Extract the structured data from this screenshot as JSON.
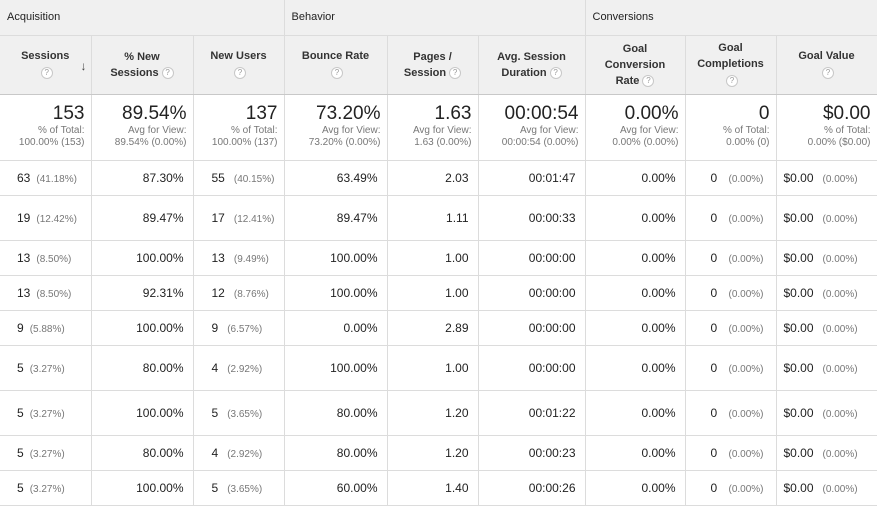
{
  "groups": {
    "acquisition": "Acquisition",
    "behavior": "Behavior",
    "conversions": "Conversions"
  },
  "columns": {
    "sessions": "Sessions",
    "new_sessions": [
      "% New",
      "Sessions"
    ],
    "new_users": "New Users",
    "bounce_rate": "Bounce Rate",
    "pages_session": [
      "Pages /",
      "Session"
    ],
    "avg_duration": [
      "Avg. Session",
      "Duration"
    ],
    "goal_conv": [
      "Goal",
      "Conversion",
      "Rate"
    ],
    "goal_compl": [
      "Goal",
      "Completions"
    ],
    "goal_value": "Goal Value",
    "help_glyph": "?",
    "sort_glyph": "↓"
  },
  "totals": {
    "sessions": {
      "value": "153",
      "l1": "% of Total:",
      "l2": "100.00% (153)"
    },
    "new_sessions": {
      "value": "89.54%",
      "l1": "Avg for View:",
      "l2": "89.54% (0.00%)"
    },
    "new_users": {
      "value": "137",
      "l1": "% of Total:",
      "l2": "100.00% (137)"
    },
    "bounce_rate": {
      "value": "73.20%",
      "l1": "Avg for View:",
      "l2": "73.20% (0.00%)"
    },
    "pages_session": {
      "value": "1.63",
      "l1": "Avg for View:",
      "l2": "1.63 (0.00%)"
    },
    "avg_duration": {
      "value": "00:00:54",
      "l1": "Avg for View:",
      "l2": "00:00:54 (0.00%)"
    },
    "goal_conv": {
      "value": "0.00%",
      "l1": "Avg for View:",
      "l2": "0.00% (0.00%)"
    },
    "goal_compl": {
      "value": "0",
      "l1": "% of Total:",
      "l2": "0.00% (0)"
    },
    "goal_value": {
      "value": "$0.00",
      "l1": "% of Total:",
      "l2": "0.00% ($0.00)"
    }
  },
  "rows": [
    {
      "s": "63",
      "sp": "(41.18%)",
      "ns": "87.30%",
      "nu": "55",
      "nup": "(40.15%)",
      "br": "63.49%",
      "ps": "2.03",
      "dur": "00:01:47",
      "gcr": "0.00%",
      "gc": "0",
      "gcp": "(0.00%)",
      "gv": "$0.00",
      "gvp": "(0.00%)"
    },
    {
      "s": "19",
      "sp": "(12.42%)",
      "ns": "89.47%",
      "nu": "17",
      "nup": "(12.41%)",
      "br": "89.47%",
      "ps": "1.11",
      "dur": "00:00:33",
      "gcr": "0.00%",
      "gc": "0",
      "gcp": "(0.00%)",
      "gv": "$0.00",
      "gvp": "(0.00%)"
    },
    {
      "s": "13",
      "sp": "(8.50%)",
      "ns": "100.00%",
      "nu": "13",
      "nup": "(9.49%)",
      "br": "100.00%",
      "ps": "1.00",
      "dur": "00:00:00",
      "gcr": "0.00%",
      "gc": "0",
      "gcp": "(0.00%)",
      "gv": "$0.00",
      "gvp": "(0.00%)"
    },
    {
      "s": "13",
      "sp": "(8.50%)",
      "ns": "92.31%",
      "nu": "12",
      "nup": "(8.76%)",
      "br": "100.00%",
      "ps": "1.00",
      "dur": "00:00:00",
      "gcr": "0.00%",
      "gc": "0",
      "gcp": "(0.00%)",
      "gv": "$0.00",
      "gvp": "(0.00%)"
    },
    {
      "s": "9",
      "sp": "(5.88%)",
      "ns": "100.00%",
      "nu": "9",
      "nup": "(6.57%)",
      "br": "0.00%",
      "ps": "2.89",
      "dur": "00:00:00",
      "gcr": "0.00%",
      "gc": "0",
      "gcp": "(0.00%)",
      "gv": "$0.00",
      "gvp": "(0.00%)"
    },
    {
      "s": "5",
      "sp": "(3.27%)",
      "ns": "80.00%",
      "nu": "4",
      "nup": "(2.92%)",
      "br": "100.00%",
      "ps": "1.00",
      "dur": "00:00:00",
      "gcr": "0.00%",
      "gc": "0",
      "gcp": "(0.00%)",
      "gv": "$0.00",
      "gvp": "(0.00%)"
    },
    {
      "s": "5",
      "sp": "(3.27%)",
      "ns": "100.00%",
      "nu": "5",
      "nup": "(3.65%)",
      "br": "80.00%",
      "ps": "1.20",
      "dur": "00:01:22",
      "gcr": "0.00%",
      "gc": "0",
      "gcp": "(0.00%)",
      "gv": "$0.00",
      "gvp": "(0.00%)"
    },
    {
      "s": "5",
      "sp": "(3.27%)",
      "ns": "80.00%",
      "nu": "4",
      "nup": "(2.92%)",
      "br": "80.00%",
      "ps": "1.20",
      "dur": "00:00:23",
      "gcr": "0.00%",
      "gc": "0",
      "gcp": "(0.00%)",
      "gv": "$0.00",
      "gvp": "(0.00%)"
    },
    {
      "s": "5",
      "sp": "(3.27%)",
      "ns": "100.00%",
      "nu": "5",
      "nup": "(3.65%)",
      "br": "60.00%",
      "ps": "1.40",
      "dur": "00:00:26",
      "gcr": "0.00%",
      "gc": "0",
      "gcp": "(0.00%)",
      "gv": "$0.00",
      "gvp": "(0.00%)"
    }
  ]
}
